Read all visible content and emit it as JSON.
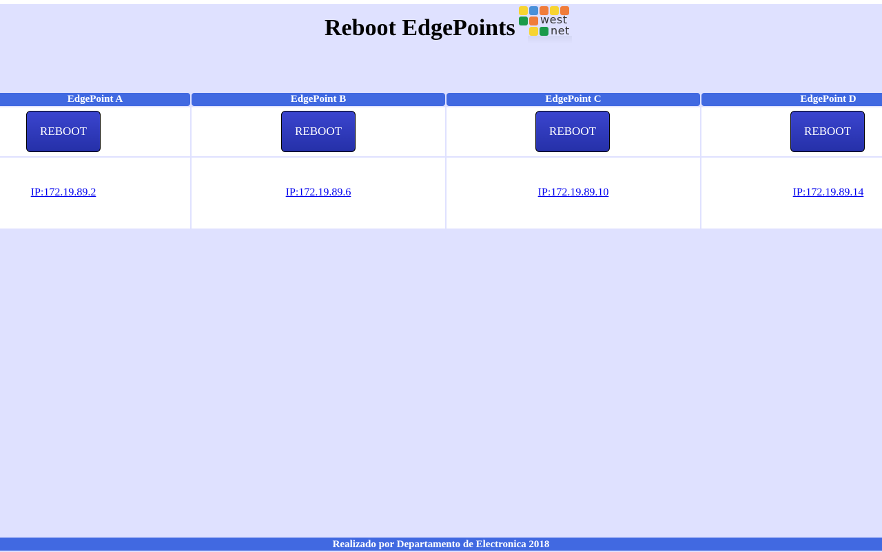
{
  "header": {
    "title": "Reboot EdgePoints",
    "logo": {
      "text_line1": "west",
      "text_line2": "net",
      "colors": [
        "#f7d431",
        "#4a90d9",
        "#f07c3a",
        "#f7d431",
        "#f07c3a",
        "#1a9a4a",
        "#f07c3a",
        "#f7d431",
        "#1a9a4a"
      ]
    }
  },
  "edgepoints": [
    {
      "name": "EdgePoint A",
      "button_label": "REBOOT",
      "ip_label": "IP:172.19.89.2"
    },
    {
      "name": "EdgePoint B",
      "button_label": "REBOOT",
      "ip_label": "IP:172.19.89.6"
    },
    {
      "name": "EdgePoint C",
      "button_label": "REBOOT",
      "ip_label": "IP:172.19.89.10"
    },
    {
      "name": "EdgePoint D",
      "button_label": "REBOOT",
      "ip_label": "IP:172.19.89.14"
    }
  ],
  "footer": {
    "text": "Realizado por Departamento de Electronica 2018"
  },
  "colors": {
    "background": "#dfe1ff",
    "header_bar": "#4169e1",
    "button": "#2f3ac0",
    "link": "#0000ee"
  }
}
